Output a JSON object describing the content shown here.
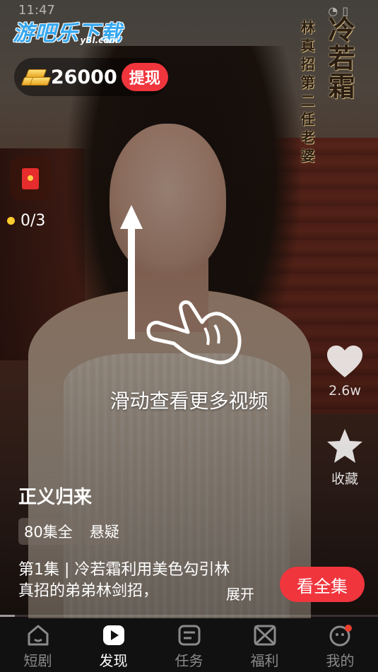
{
  "status": {
    "time": "11:47"
  },
  "watermark": {
    "logo_main": "游吧乐下载",
    "logo_sub": "yBl.com"
  },
  "calligraphy": {
    "big": "冷若霜",
    "small": "林真招第二任老婆"
  },
  "wallet": {
    "amount": "26000",
    "withdraw_label": "提现"
  },
  "red_packet": {
    "progress_text": "0/3"
  },
  "swipe_hint": {
    "text": "滑动查看更多视频"
  },
  "actions": {
    "like_count": "2.6w",
    "favorite_label": "收藏"
  },
  "drama": {
    "title": "正义归来",
    "tags": [
      "80集全",
      "悬疑"
    ],
    "description": "第1集 | 冷若霜利用美色勾引林真招的弟弟林剑招，",
    "expand_label": "展开",
    "watch_all_label": "看全集",
    "progress": 0.04
  },
  "nav": {
    "items": [
      {
        "label": "短剧",
        "icon": "home-icon",
        "active": false
      },
      {
        "label": "发现",
        "icon": "play-icon",
        "active": true
      },
      {
        "label": "任务",
        "icon": "task-icon",
        "active": false
      },
      {
        "label": "福利",
        "icon": "gift-icon",
        "active": false
      },
      {
        "label": "我的",
        "icon": "profile-icon",
        "active": false
      }
    ]
  },
  "colors": {
    "accent_red": "#f0353d",
    "coin_gold": "#ffcc2e",
    "nav_bg": "#111111"
  }
}
